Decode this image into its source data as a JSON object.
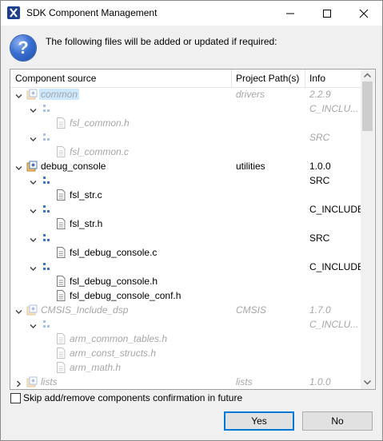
{
  "window": {
    "title": "SDK Component Management",
    "icon": "app-icon",
    "controls": [
      "minimize-icon",
      "maximize-icon",
      "close-icon"
    ]
  },
  "header": {
    "icon": "question-icon",
    "icon_glyph": "?",
    "message": "The following files will be added or updated if required:"
  },
  "tree": {
    "columns": {
      "source": "Component source",
      "path": "Project Path(s)",
      "info": "Info"
    },
    "rows": [
      {
        "level": 0,
        "kind": "component",
        "label": "common",
        "path": "drivers",
        "info": "2.2.9",
        "greyed": true,
        "selected": true,
        "twisty": "expanded"
      },
      {
        "level": 1,
        "kind": "group",
        "label": "",
        "path": "",
        "info": "C_INCLU...",
        "greyed": true,
        "twisty": "expanded"
      },
      {
        "level": 2,
        "kind": "file",
        "label": "fsl_common.h",
        "path": "",
        "info": "",
        "greyed": true
      },
      {
        "level": 1,
        "kind": "group",
        "label": "",
        "path": "",
        "info": "SRC",
        "greyed": true,
        "twisty": "expanded"
      },
      {
        "level": 2,
        "kind": "file",
        "label": "fsl_common.c",
        "path": "",
        "info": "",
        "greyed": true
      },
      {
        "level": 0,
        "kind": "component",
        "label": "debug_console",
        "path": "utilities",
        "info": "1.0.0",
        "greyed": false,
        "twisty": "expanded"
      },
      {
        "level": 1,
        "kind": "group",
        "label": "",
        "path": "",
        "info": "SRC",
        "greyed": false,
        "twisty": "expanded"
      },
      {
        "level": 2,
        "kind": "file",
        "label": "fsl_str.c",
        "path": "",
        "info": "",
        "greyed": false
      },
      {
        "level": 1,
        "kind": "group",
        "label": "",
        "path": "",
        "info": "C_INCLUDE",
        "greyed": false,
        "twisty": "expanded"
      },
      {
        "level": 2,
        "kind": "file",
        "label": "fsl_str.h",
        "path": "",
        "info": "",
        "greyed": false
      },
      {
        "level": 1,
        "kind": "group",
        "label": "",
        "path": "",
        "info": "SRC",
        "greyed": false,
        "twisty": "expanded"
      },
      {
        "level": 2,
        "kind": "file",
        "label": "fsl_debug_console.c",
        "path": "",
        "info": "",
        "greyed": false
      },
      {
        "level": 1,
        "kind": "group",
        "label": "",
        "path": "",
        "info": "C_INCLUDE",
        "greyed": false,
        "twisty": "expanded"
      },
      {
        "level": 2,
        "kind": "file",
        "label": "fsl_debug_console.h",
        "path": "",
        "info": "",
        "greyed": false
      },
      {
        "level": 2,
        "kind": "file",
        "label": "fsl_debug_console_conf.h",
        "path": "",
        "info": "",
        "greyed": false
      },
      {
        "level": 0,
        "kind": "component",
        "label": "CMSIS_Include_dsp",
        "path": "CMSIS",
        "info": "1.7.0",
        "greyed": true,
        "twisty": "expanded"
      },
      {
        "level": 1,
        "kind": "group",
        "label": "",
        "path": "",
        "info": "C_INCLU...",
        "greyed": true,
        "twisty": "expanded"
      },
      {
        "level": 2,
        "kind": "file",
        "label": "arm_common_tables.h",
        "path": "",
        "info": "",
        "greyed": true
      },
      {
        "level": 2,
        "kind": "file",
        "label": "arm_const_structs.h",
        "path": "",
        "info": "",
        "greyed": true
      },
      {
        "level": 2,
        "kind": "file",
        "label": "arm_math.h",
        "path": "",
        "info": "",
        "greyed": true
      },
      {
        "level": 0,
        "kind": "component",
        "label": "lists",
        "path": "lists",
        "info": "1.0.0",
        "greyed": true,
        "twisty": "collapsed"
      }
    ]
  },
  "footer": {
    "skip_label": "Skip add/remove components confirmation in future",
    "skip_checked": false,
    "yes_label": "Yes",
    "no_label": "No"
  }
}
